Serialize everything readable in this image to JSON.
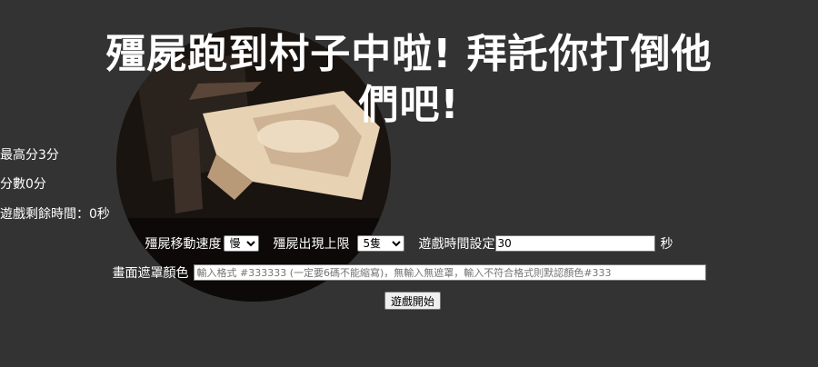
{
  "page": {
    "background_color": "#333333",
    "title": "殭屍跑到村子中啦! 拜託你打倒他們吧!"
  },
  "stats": {
    "high_score": "最高分3分",
    "score": "分數0分",
    "time_left": "遊戲剩餘時間：0秒"
  },
  "controls": {
    "speed_label": "殭屍移動速度",
    "speed_options": [
      "慢"
    ],
    "speed_selected": "慢",
    "max_label": "殭屍出現上限",
    "max_options": [
      "5隻"
    ],
    "max_selected": "5隻",
    "time_label": "遊戲時間設定",
    "time_value": "30",
    "time_unit": "秒"
  },
  "mask": {
    "label": "畫面遮罩顏色",
    "placeholder": "輸入格式 #333333 (一定要6碼不能縮寫)，無輸入無遮罩，輸入不符合格式則默認顏色#333"
  },
  "start_button": {
    "label": "遊戲開始"
  }
}
